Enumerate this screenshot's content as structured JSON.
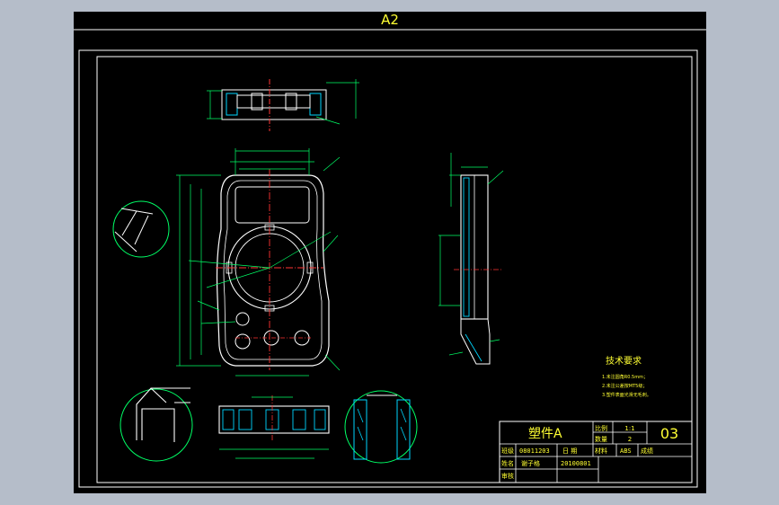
{
  "sheet": {
    "size_label": "A2",
    "background": "#000000",
    "frame_color": "#ffffff",
    "outline_color": "#ffffff",
    "dim_color": "#00ff66",
    "center_color": "#ff3333",
    "text_color": "#ffff33",
    "hatch_color": "#00d6ff"
  },
  "title_block": {
    "part_name": "塑件A",
    "drawing_no": "03",
    "scale_label": "比例",
    "scale_value": "1:1",
    "qty_label": "数量",
    "qty_value": "2",
    "row3_label": "班级",
    "row3_value": "08011203",
    "date_label": "日 期",
    "material_label": "材料",
    "material_value": "ABS",
    "grade_label": "成绩",
    "name_label": "姓名",
    "name_value": "谢子格",
    "id_value": "20100801",
    "review_label": "审核"
  },
  "notes": {
    "title": "技术要求",
    "lines": [
      "1.未注圆角R0.5mm；",
      "2.未注公差按MT5级；",
      "3.塑件表面光滑无毛刺。"
    ]
  }
}
